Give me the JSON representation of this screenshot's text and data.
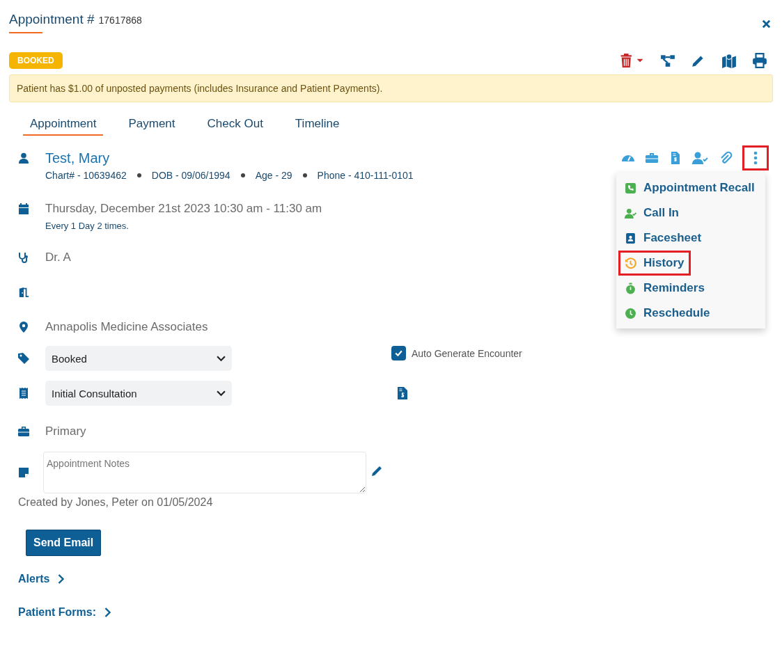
{
  "header": {
    "title": "Appointment #",
    "number": "17617868"
  },
  "status_badge": "BOOKED",
  "alert": "Patient has $1.00 of unposted payments (includes Insurance and Patient Payments).",
  "tabs": [
    {
      "label": "Appointment",
      "selected": true
    },
    {
      "label": "Payment",
      "selected": false
    },
    {
      "label": "Check Out",
      "selected": false
    },
    {
      "label": "Timeline",
      "selected": false
    }
  ],
  "patient": {
    "name": "Test, Mary",
    "details": [
      "Chart# - 10639462",
      "DOB - 09/06/1994",
      "Age - 29",
      "Phone - 410-111-0101"
    ]
  },
  "schedule": {
    "datetime": "Thursday, December 21st 2023 10:30 am - 11:30 am",
    "recurrence": "Every 1 Day 2 times."
  },
  "provider": "Dr. A",
  "location": "Annapolis Medicine Associates",
  "status_select": {
    "value": "Booked"
  },
  "auto_generate": {
    "label": "Auto Generate Encounter",
    "checked": true
  },
  "type_select": {
    "value": "Initial Consultation"
  },
  "insurance": "Primary",
  "notes": {
    "placeholder": "Appointment Notes"
  },
  "created": "Created by Jones, Peter on 01/05/2024",
  "send_email": "Send Email",
  "alerts": "Alerts",
  "patient_forms": "Patient Forms:",
  "more_menu": {
    "open": true,
    "highlighted": true,
    "items": [
      {
        "label": "Appointment Recall",
        "kind": "recall",
        "color": "#4caf50",
        "highlighted": false
      },
      {
        "label": "Call In",
        "kind": "callin",
        "color": "#4caf50",
        "highlighted": false
      },
      {
        "label": "Facesheet",
        "kind": "facesheet",
        "color": "#0e5f96",
        "highlighted": false
      },
      {
        "label": "History",
        "kind": "history",
        "color": "#f5a623",
        "highlighted": true
      },
      {
        "label": "Reminders",
        "kind": "reminders",
        "color": "#4caf50",
        "highlighted": false
      },
      {
        "label": "Reschedule",
        "kind": "reschedule",
        "color": "#4caf50",
        "highlighted": false
      }
    ]
  }
}
